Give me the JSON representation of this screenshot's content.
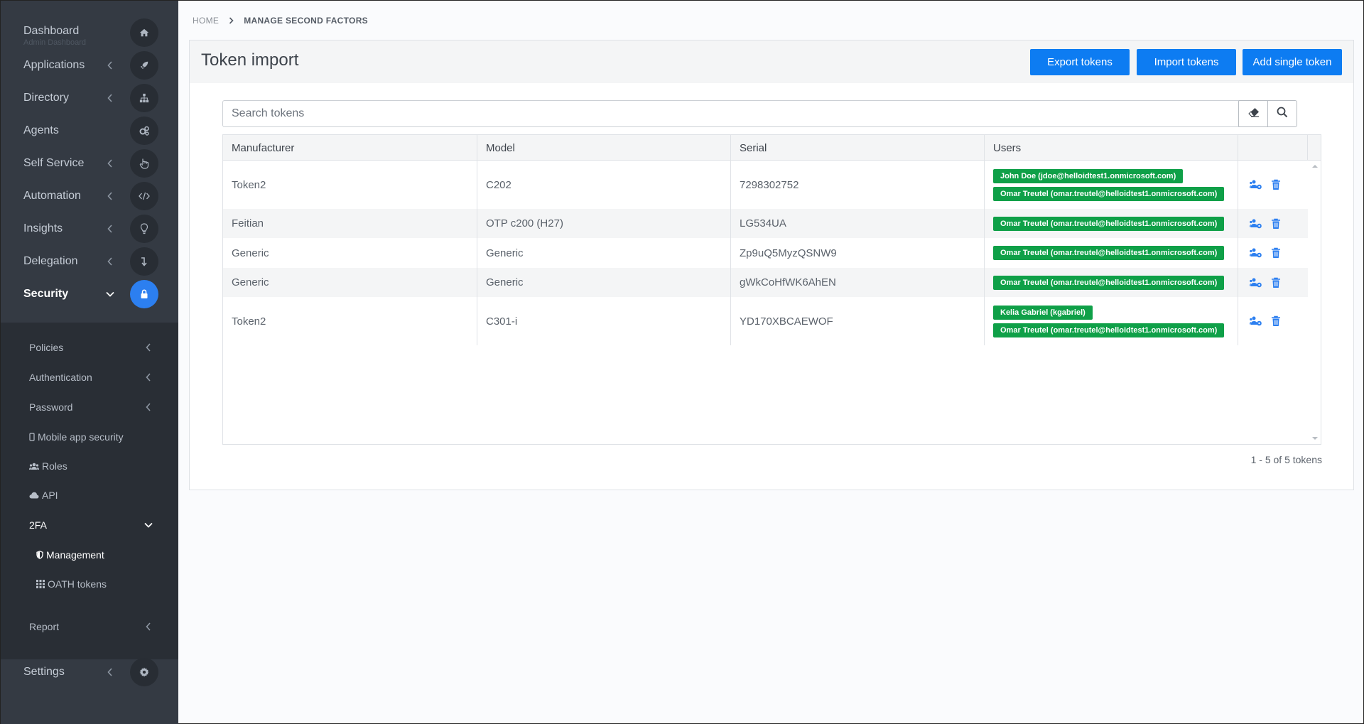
{
  "sidebar": {
    "dashboard": {
      "label": "Dashboard",
      "sublabel": "Admin Dashboard",
      "icon": "home-icon"
    },
    "items": [
      {
        "label": "Applications",
        "icon": "rocket-icon"
      },
      {
        "label": "Directory",
        "icon": "sitemap-icon"
      },
      {
        "label": "Agents",
        "icon": "cogs-icon"
      },
      {
        "label": "Self Service",
        "icon": "hand-pointer-icon"
      },
      {
        "label": "Automation",
        "icon": "code-icon"
      },
      {
        "label": "Insights",
        "icon": "lightbulb-icon"
      },
      {
        "label": "Delegation",
        "icon": "level-down-icon"
      },
      {
        "label": "Security",
        "icon": "lock-icon"
      }
    ],
    "security_sub": [
      {
        "label": "Policies"
      },
      {
        "label": "Authentication"
      },
      {
        "label": "Password"
      },
      {
        "label": "Mobile app security",
        "icon": "mobile-icon"
      },
      {
        "label": "Roles",
        "icon": "users-icon"
      },
      {
        "label": "API",
        "icon": "cloud-icon"
      },
      {
        "label": "2FA"
      },
      {
        "label": "Management",
        "icon": "shield-icon"
      },
      {
        "label": "OATH tokens",
        "icon": "grid-icon"
      },
      {
        "label": "Report"
      }
    ],
    "settings": {
      "label": "Settings",
      "icon": "gear-icon"
    }
  },
  "breadcrumb": {
    "home": "HOME",
    "current": "MANAGE SECOND FACTORS"
  },
  "page": {
    "title": "Token import",
    "buttons": {
      "export": "Export tokens",
      "import": "Import tokens",
      "add": "Add single token"
    },
    "search_placeholder": "Search tokens"
  },
  "table": {
    "columns": [
      "Manufacturer",
      "Model",
      "Serial",
      "Users"
    ],
    "rows": [
      {
        "manufacturer": "Token2",
        "model": "C202",
        "serial": "7298302752",
        "users": [
          "John Doe (jdoe@helloidtest1.onmicrosoft.com)",
          "Omar Treutel (omar.treutel@helloidtest1.onmicrosoft.com)"
        ]
      },
      {
        "manufacturer": "Feitian",
        "model": "OTP c200 (H27)",
        "serial": "LG534UA",
        "users": [
          "Omar Treutel (omar.treutel@helloidtest1.onmicrosoft.com)"
        ]
      },
      {
        "manufacturer": "Generic",
        "model": "Generic",
        "serial": "Zp9uQ5MyzQSNW9",
        "users": [
          "Omar Treutel (omar.treutel@helloidtest1.onmicrosoft.com)"
        ]
      },
      {
        "manufacturer": "Generic",
        "model": "Generic",
        "serial": "gWkCoHfWK6AhEN",
        "users": [
          "Omar Treutel (omar.treutel@helloidtest1.onmicrosoft.com)"
        ]
      },
      {
        "manufacturer": "Token2",
        "model": "C301-i",
        "serial": "YD170XBCAEWOF",
        "users": [
          "Kelia Gabriel (kgabriel)",
          "Omar Treutel (omar.treutel@helloidtest1.onmicrosoft.com)"
        ]
      }
    ],
    "pager": "1 - 5 of 5 tokens"
  },
  "colors": {
    "accent": "#0d7cf2",
    "badge": "#0fa048",
    "sidebar": "#343a43",
    "sidebar_sub": "#292e35"
  }
}
